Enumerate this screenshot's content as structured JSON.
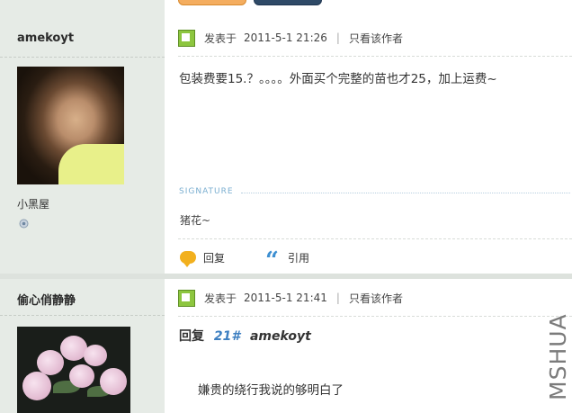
{
  "posts": [
    {
      "username": "amekoyt",
      "user_title": "小黑屋",
      "meta": {
        "posted_label": "发表于",
        "datetime": "2011-5-1 21:26",
        "only_author": "只看该作者"
      },
      "content": "包装费要15.？。。。。外面买个完整的苗也才25，加上运费~",
      "signature_label": "SIGNATURE",
      "signature": "猪花~",
      "actions": {
        "reply": "回复",
        "quote": "引用"
      }
    },
    {
      "username": "偷心俏静静",
      "meta": {
        "posted_label": "发表于",
        "datetime": "2011-5-1 21:41",
        "only_author": "只看该作者"
      },
      "reply_label": "回复",
      "reply_floor": "21#",
      "reply_author": "amekoyt",
      "content": "嫌贵的绕行我说的够明白了"
    }
  ],
  "watermark": "MSHUA",
  "icons": {
    "post_flag": "post-flag-icon",
    "online": "online-status-icon",
    "reply": "reply-bubble-icon",
    "quote": "quote-icon"
  },
  "colors": {
    "link_blue": "#3d7fc1",
    "sidebar_bg": "#e6ebe6",
    "flag_green": "#8dc63f"
  }
}
